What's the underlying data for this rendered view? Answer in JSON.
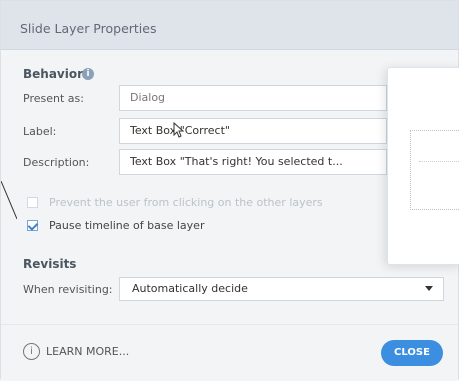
{
  "dialog": {
    "title": "Slide Layer Properties",
    "behavior_title": "Behavior",
    "present_as_label": "Present as:",
    "present_as_value": "Dialog",
    "label_label": "Label:",
    "label_value": "Text Box \"Correct\"",
    "description_label": "Description:",
    "description_value": "Text Box \"That's right!  You selected t...",
    "prevent_label": "Prevent the user from clicking on the other layers",
    "pause_label": "Pause timeline of base layer",
    "revisits_title": "Revisits",
    "when_revisiting_label": "When revisiting:",
    "when_revisiting_value": "Automatically decide",
    "learn_more": "LEARN MORE...",
    "close": "CLOSE"
  },
  "icons": {
    "info": "info-icon",
    "learn": "info-circle-icon",
    "dropdown": "chevron-down-icon"
  },
  "colors": {
    "accent": "#3b8ee0",
    "title_bar": "#dfe4ea",
    "background": "#f3f4f5"
  }
}
